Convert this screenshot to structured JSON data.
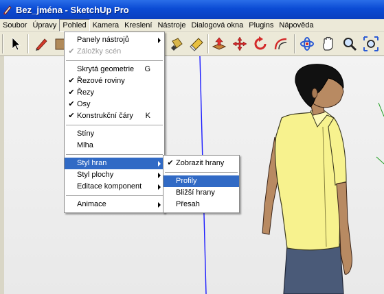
{
  "window": {
    "title": "Bez_jména - SketchUp Pro"
  },
  "menubar": [
    {
      "label": "Soubor",
      "name": "menu-soubor"
    },
    {
      "label": "Úpravy",
      "name": "menu-upravy"
    },
    {
      "label": "Pohled",
      "name": "menu-pohled",
      "active": true
    },
    {
      "label": "Kamera",
      "name": "menu-kamera"
    },
    {
      "label": "Kreslení",
      "name": "menu-kresleni"
    },
    {
      "label": "Nástroje",
      "name": "menu-nastroje"
    },
    {
      "label": "Dialogová okna",
      "name": "menu-dialogova-okna"
    },
    {
      "label": "Plugins",
      "name": "menu-plugins"
    },
    {
      "label": "Nápověda",
      "name": "menu-napoveda"
    }
  ],
  "pohled_menu": {
    "items": [
      {
        "label": "Panely nástrojů",
        "submenu": true
      },
      {
        "label": "Záložky scén",
        "checked": true,
        "disabled": true
      },
      {
        "label": "Skrytá geometrie",
        "shortcut": "G"
      },
      {
        "label": "Řezové roviny",
        "checked": true
      },
      {
        "label": "Řezy",
        "checked": true
      },
      {
        "label": "Osy",
        "checked": true
      },
      {
        "label": "Konstrukční čáry",
        "checked": true,
        "shortcut": "K"
      },
      {
        "label": "Stíny"
      },
      {
        "label": "Mlha"
      },
      {
        "label": "Styl hran",
        "submenu": true,
        "highlight": true
      },
      {
        "label": "Styl plochy",
        "submenu": true
      },
      {
        "label": "Editace komponent",
        "submenu": true
      },
      {
        "label": "Animace",
        "submenu": true
      }
    ]
  },
  "styl_hran_submenu": {
    "items": [
      {
        "label": "Zobrazit hrany",
        "checked": true
      },
      {
        "label": "Profily",
        "highlight": true
      },
      {
        "label": "Bližší hrany"
      },
      {
        "label": "Přesah"
      }
    ]
  },
  "glyphs": {
    "check": "✔"
  },
  "colors": {
    "titlebar": "#0b4bd4",
    "menu_highlight": "#316ac5",
    "axis_blue": "#1a1aff",
    "shirt": "#f7f28e"
  }
}
